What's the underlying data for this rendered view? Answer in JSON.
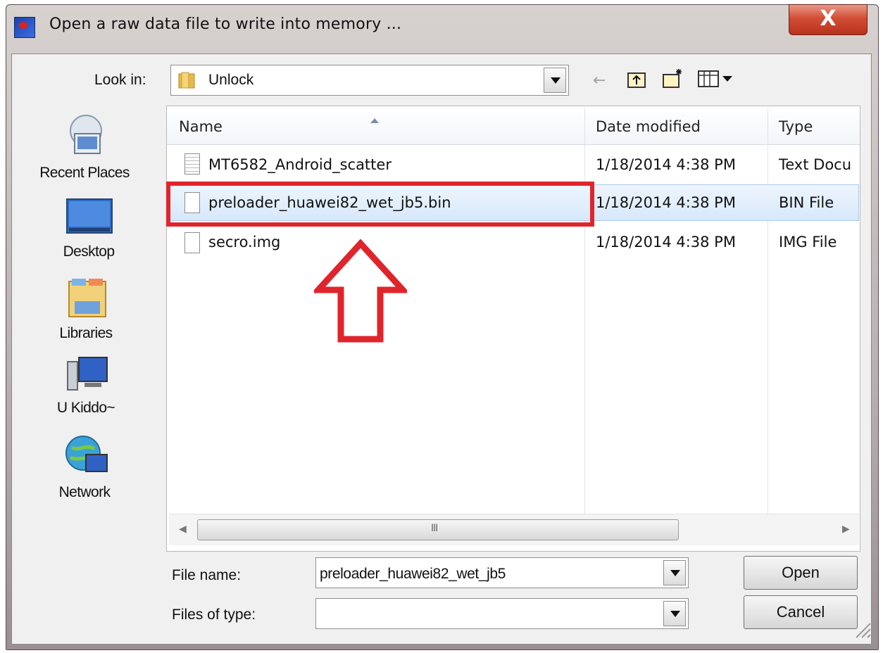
{
  "window": {
    "title": "Open a raw data file to write into memory ...",
    "close_glyph": "X"
  },
  "toolbar": {
    "look_in_label": "Look in:",
    "look_in_value": "Unlock"
  },
  "places": [
    {
      "label": "Recent Places",
      "icon": "recent-places-icon"
    },
    {
      "label": "Desktop",
      "icon": "desktop-icon"
    },
    {
      "label": "Libraries",
      "icon": "libraries-icon"
    },
    {
      "label": "U Kiddo~",
      "icon": "computer-icon"
    },
    {
      "label": "Network",
      "icon": "network-icon"
    }
  ],
  "file_list": {
    "columns": [
      "Name",
      "Date modified",
      "Type"
    ],
    "rows": [
      {
        "name": "MT6582_Android_scatter",
        "date": "1/18/2014 4:38 PM",
        "type": "Text Docu",
        "selected": false
      },
      {
        "name": "preloader_huawei82_wet_jb5.bin",
        "date": "1/18/2014 4:38 PM",
        "type": "BIN File",
        "selected": true
      },
      {
        "name": "secro.img",
        "date": "1/18/2014 4:38 PM",
        "type": "IMG File",
        "selected": false
      }
    ]
  },
  "scrollbar": {
    "grip": "III"
  },
  "form": {
    "file_name_label": "File name:",
    "file_name_value": "preloader_huawei82_wet_jb5",
    "file_type_label": "Files of type:",
    "file_type_value": ""
  },
  "buttons": {
    "open": "Open",
    "cancel": "Cancel"
  },
  "colors": {
    "annotation": "#e0242c",
    "selection": "#d7e8fb"
  }
}
